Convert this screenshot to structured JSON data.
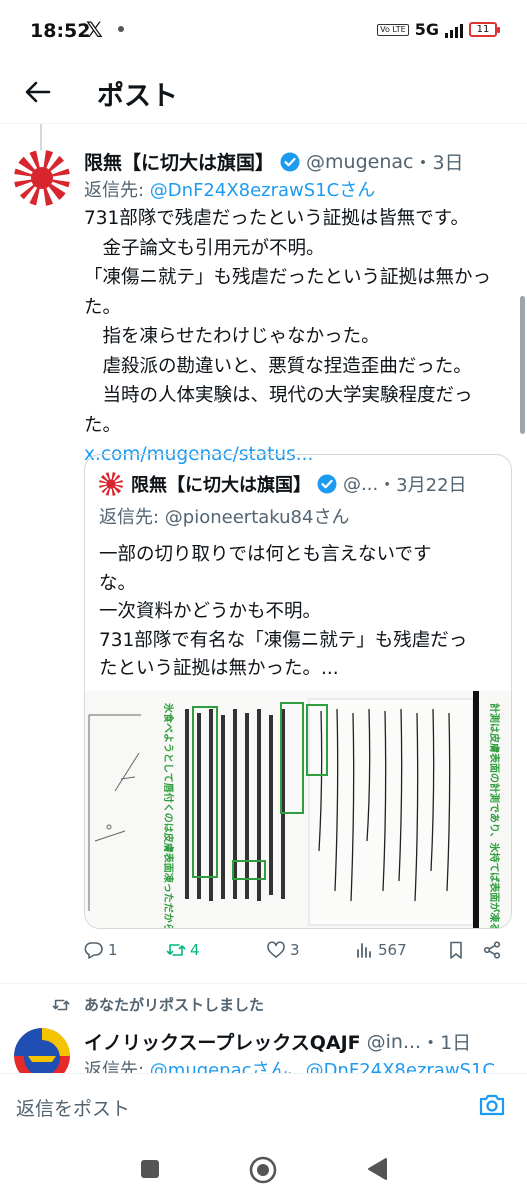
{
  "status_bar": {
    "time": "18:52",
    "x_icon": "x-logo",
    "volte": "Vo LTE",
    "network": "5G",
    "battery": "11"
  },
  "header": {
    "title": "ポスト",
    "back_icon": "arrow-left-icon"
  },
  "tweet": {
    "name": "限無【に切大は旗国】",
    "handle": "@mugenac",
    "time": "・3日",
    "reply_prefix": "返信先: ",
    "reply_target": "@DnF24X8ezrawS1Cさん",
    "lines": [
      "731部隊で残虐だったという証拠は皆無です。",
      "　金子論文も引用元が不明。",
      "「凍傷ニ就テ」も残虐だったという証拠は無かった。",
      "　指を凍らせたわけじゃなかった。",
      "　虐殺派の勘違いと、悪質な捏造歪曲だった。",
      "　当時の人体実験は、現代の大学実験程度だった。"
    ],
    "link": "x.com/mugenac/status..."
  },
  "quote": {
    "name": "限無【に切大は旗国】",
    "handle": "@...",
    "time": "・3月22日",
    "reply_prefix": "返信先: ",
    "reply_target": "@pioneertaku84さん",
    "body": "一部の切り取りでは何とも言えないです\nな。\n一次資料かどうかも不明。\n731部隊で有名な「凍傷ニ就テ」も残虐だっ\nたという証拠は無かった。...",
    "image_left_caption": "氷食べようとして唇付くのは皮膚表面凍っただから。そういう話。",
    "image_right_caption": "計測は皮膚表面の計測であり、氷持てば表面が凍る。指ら凍るような話ではない。"
  },
  "actions": {
    "replies": "1",
    "reposts": "4",
    "likes": "3",
    "views": "567"
  },
  "reposted": {
    "label": "あなたがリポストしました"
  },
  "next_tweet": {
    "name": "イノリックスープレックスQAJF",
    "handle": "@in...",
    "time": "・1日",
    "reply_prefix": "返信先: ",
    "reply_target": "@mugenacさん、@DnF24X8ezrawS1C"
  },
  "reply_bar": {
    "placeholder": "返信をポスト"
  },
  "colors": {
    "accent": "#1d9bf0",
    "secondary_text": "#536471",
    "primary_text": "#0f1419",
    "border": "#cfd9de"
  }
}
